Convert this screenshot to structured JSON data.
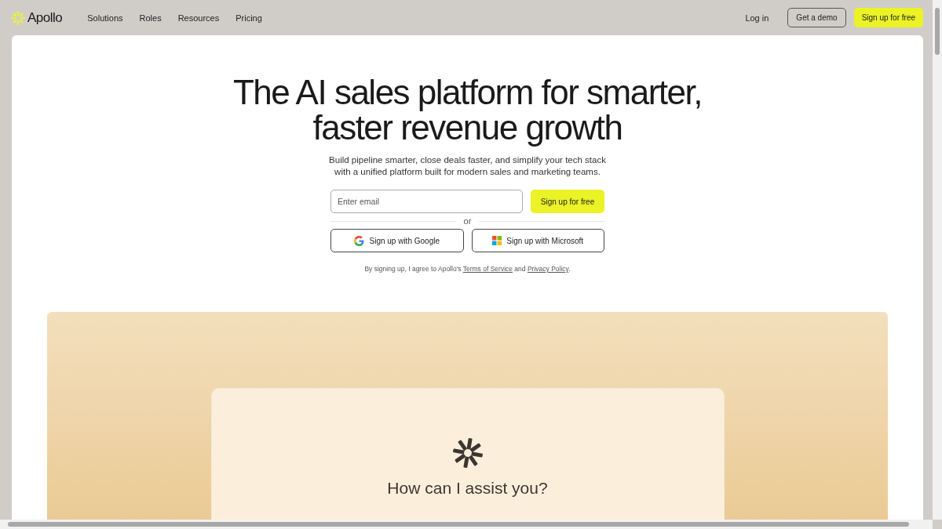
{
  "nav": {
    "brand": "Apollo",
    "links": [
      "Solutions",
      "Roles",
      "Resources",
      "Pricing"
    ],
    "login": "Log in",
    "demo": "Get a demo",
    "signup": "Sign up for free"
  },
  "hero": {
    "title_lines": [
      "The AI sales platform for smarter,",
      "faster revenue growth"
    ],
    "subtitle_lines": [
      "Build pipeline smarter, close deals faster, and simplify your tech stack",
      "with a unified platform built for modern sales and marketing teams."
    ],
    "email": {
      "placeholder": "Enter email"
    },
    "signup": "Sign up for free",
    "divider": "or",
    "sso": [
      {
        "kind": "google",
        "label": "Sign up with Google"
      },
      {
        "kind": "microsoft",
        "label": "Sign up with Microsoft"
      }
    ],
    "legal": {
      "before": "By signing up, I agree to Apollo's",
      "terms": "Terms of Service",
      "middle": "and",
      "privacy": "Privacy Policy",
      "after": "."
    }
  },
  "assistant": {
    "prompt": "How can I assist you?"
  }
}
